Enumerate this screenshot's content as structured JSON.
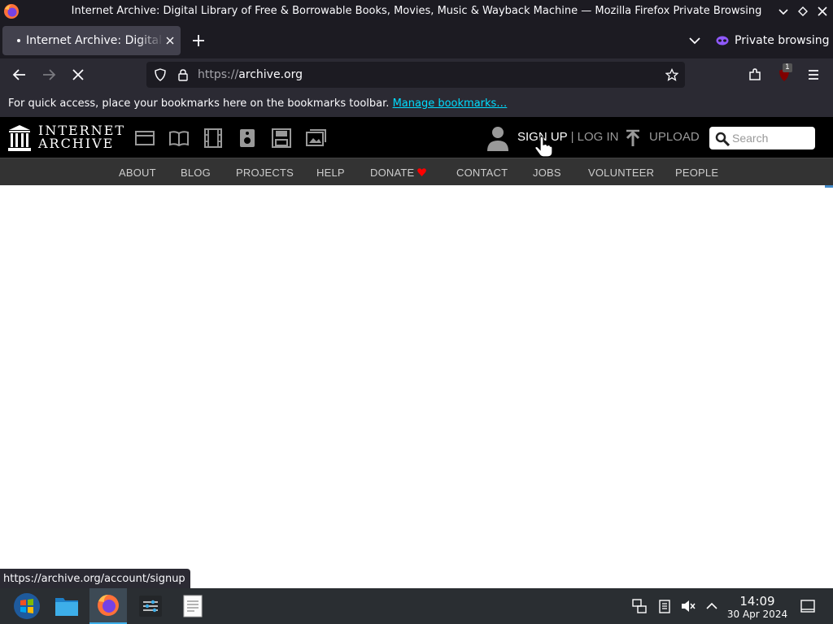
{
  "window": {
    "title": "Internet Archive: Digital Library of Free & Borrowable Books, Movies, Music & Wayback Machine — Mozilla Firefox Private Browsing"
  },
  "tabs": [
    {
      "label": "Internet Archive: Digital Library of Free & Borrowable Books, Movies, Music & Wayback Machine"
    }
  ],
  "private_browsing_label": "Private browsing",
  "urlbar": {
    "scheme": "https://",
    "host": "archive.org"
  },
  "bookmarks_bar": {
    "message": "For quick access, place your bookmarks here on the bookmarks toolbar.",
    "link": "Manage bookmarks…"
  },
  "ia": {
    "logo": {
      "line1": "INTERNET",
      "line2": "ARCHIVE"
    },
    "media_icons": [
      "web-icon",
      "texts-icon",
      "video-icon",
      "audio-icon",
      "software-icon",
      "images-icon"
    ],
    "sign_up": "SIGN UP",
    "separator": "|",
    "log_in": "LOG IN",
    "upload": "UPLOAD",
    "search_placeholder": "Search",
    "nav": [
      "ABOUT",
      "BLOG",
      "PROJECTS",
      "HELP",
      "DONATE",
      "CONTACT",
      "JOBS",
      "VOLUNTEER",
      "PEOPLE"
    ]
  },
  "status_link": "https://archive.org/account/signup",
  "taskbar": {
    "apps": [
      "start-menu-icon",
      "file-manager-icon",
      "firefox-icon",
      "settings-icon",
      "text-editor-icon"
    ],
    "time": "14:09",
    "date": "30 Apr 2024"
  },
  "extension_badge_count": "1",
  "colors": {
    "browser_frame": "#1c1b22",
    "toolbar": "#2b2a33",
    "ia_header": "#000000",
    "ia_nav": "#333333",
    "link": "#00ddff",
    "heart": "#ff0000",
    "taskbar": "#2a2e32",
    "accent": "#3daee9"
  }
}
